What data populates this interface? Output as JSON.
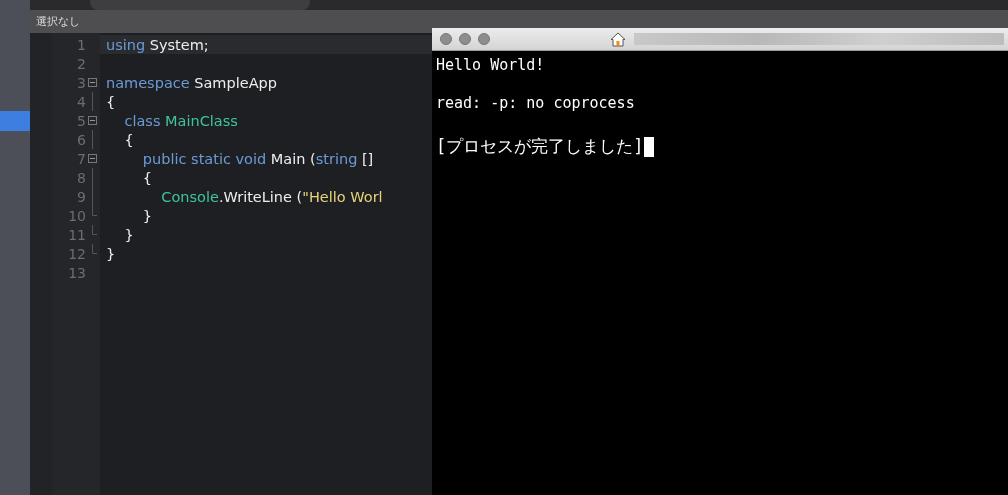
{
  "toolbar": {
    "status": "選択なし"
  },
  "editor": {
    "lines": [
      {
        "number": "1",
        "current": true,
        "tokens": [
          {
            "kind": "keyword",
            "text": "using"
          },
          {
            "kind": "plain",
            "text": " System;"
          }
        ]
      },
      {
        "number": "2",
        "current": false
      },
      {
        "number": "3",
        "current": false,
        "fold_start": true,
        "tokens": [
          {
            "kind": "keyword",
            "text": "namespace"
          },
          {
            "kind": "plain",
            "text": " SampleApp"
          }
        ]
      },
      {
        "number": "4",
        "current": false,
        "fold_inner": true,
        "tokens": [
          {
            "kind": "plain",
            "text": "{"
          }
        ]
      },
      {
        "number": "5",
        "current": false,
        "fold_start": true,
        "tokens": [
          {
            "kind": "keyword",
            "text": "    class"
          },
          {
            "kind": "type",
            "text": " MainClass"
          }
        ]
      },
      {
        "number": "6",
        "current": false,
        "fold_inner": true,
        "tokens": [
          {
            "kind": "plain",
            "text": "    {"
          }
        ]
      },
      {
        "number": "7",
        "current": false,
        "fold_start": true,
        "tokens": [
          {
            "kind": "keyword",
            "text": "        public static void"
          },
          {
            "kind": "plain",
            "text": " Main ("
          },
          {
            "kind": "keyword",
            "text": "string"
          },
          {
            "kind": "plain",
            "text": " []"
          }
        ]
      },
      {
        "number": "8",
        "current": false,
        "fold_inner": true,
        "tokens": [
          {
            "kind": "plain",
            "text": "        {"
          }
        ]
      },
      {
        "number": "9",
        "current": false,
        "fold_inner": true,
        "tokens": [
          {
            "kind": "type",
            "text": "            Console"
          },
          {
            "kind": "plain",
            "text": ".WriteLine ("
          },
          {
            "kind": "string",
            "text": "\"Hello Worl"
          }
        ]
      },
      {
        "number": "10",
        "current": false,
        "fold_end": true,
        "tokens": [
          {
            "kind": "plain",
            "text": "        }"
          }
        ]
      },
      {
        "number": "11",
        "current": false,
        "fold_end": true,
        "tokens": [
          {
            "kind": "plain",
            "text": "    }"
          }
        ]
      },
      {
        "number": "12",
        "current": false,
        "fold_end": true,
        "tokens": [
          {
            "kind": "plain",
            "text": "}"
          }
        ]
      },
      {
        "number": "13",
        "current": false
      }
    ]
  },
  "terminal": {
    "cursor": true,
    "lines": [
      "Hello World!",
      "read: -p: no coprocess",
      "[プロセスが完了しました]"
    ]
  }
}
